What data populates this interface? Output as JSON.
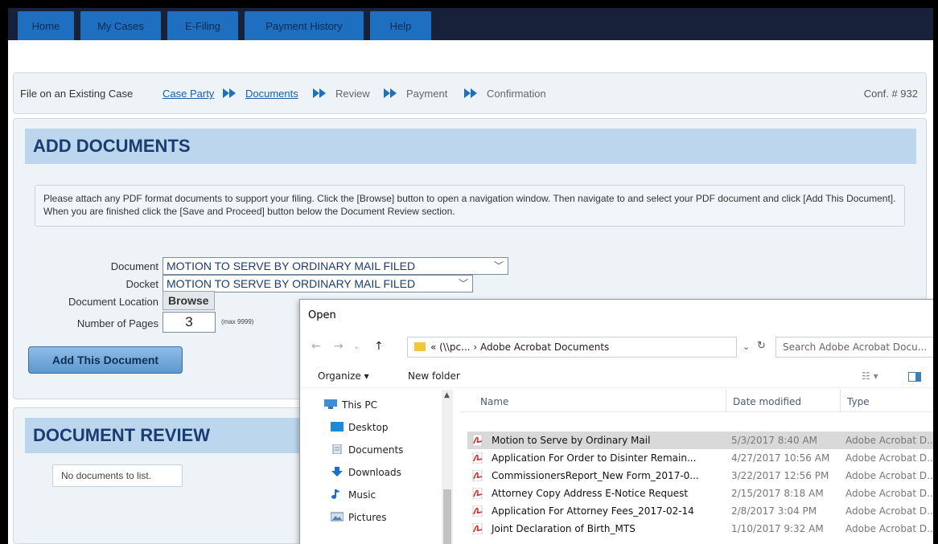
{
  "nav": {
    "tabs": [
      "Home",
      "My Cases",
      "E-Filing",
      "Payment History",
      "Help"
    ]
  },
  "breadcrumb": {
    "lead": "File on an Existing Case",
    "steps": [
      "Case Party",
      "Documents",
      "Review",
      "Payment",
      "Confirmation"
    ],
    "conf": "Conf. # 932"
  },
  "add_documents": {
    "title": "ADD DOCUMENTS",
    "instructions": "Please attach any PDF format documents to support your filing. Click the [Browse] button to open a navigation window. Then navigate to and select your PDF document and click [Add This Document]. When you are finished click the [Save and Proceed] button below the Document Review section.",
    "document_label": "Document",
    "document_value": "MOTION TO SERVE BY ORDINARY MAIL FILED",
    "docket_label": "Docket",
    "docket_value": "MOTION TO SERVE BY ORDINARY MAIL FILED",
    "location_label": "Document Location",
    "browse_label": "Browse",
    "pages_label": "Number of Pages",
    "pages_value": "3",
    "pages_max": "(max 9999)",
    "add_button": "Add This Document"
  },
  "document_review": {
    "title": "DOCUMENT REVIEW",
    "empty_text": "No documents to list."
  },
  "dialog": {
    "title": "Open",
    "address": "« (\\\\pc...  ›  Adobe Acrobat Documents",
    "search_placeholder": "Search Adobe Acrobat Docu...",
    "organize": "Organize ▾",
    "new_folder": "New folder",
    "columns": {
      "name": "Name",
      "date": "Date modified",
      "type": "Type"
    },
    "nav_items": [
      "This PC",
      "Desktop",
      "Documents",
      "Downloads",
      "Music",
      "Pictures"
    ],
    "files": [
      {
        "name": "Motion to Serve by Ordinary Mail",
        "date": "5/3/2017 8:40 AM",
        "type": "Adobe Acrobat D..."
      },
      {
        "name": "Application For Order to Disinter Remain...",
        "date": "4/27/2017 10:56 AM",
        "type": "Adobe Acrobat D..."
      },
      {
        "name": "CommissionersReport_New Form_2017-0...",
        "date": "3/22/2017 12:56 PM",
        "type": "Adobe Acrobat D..."
      },
      {
        "name": "Attorney Copy Address E-Notice Request",
        "date": "2/15/2017 8:18 AM",
        "type": "Adobe Acrobat D..."
      },
      {
        "name": "Application For Attorney Fees_2017-02-14",
        "date": "2/8/2017 3:04 PM",
        "type": "Adobe Acrobat D..."
      },
      {
        "name": "Joint Declaration of Birth_MTS",
        "date": "1/10/2017 9:32 AM",
        "type": "Adobe Acrobat D..."
      }
    ],
    "colors": {
      "accent": "#1e6fbf",
      "selection": "#d9d9d9",
      "pdf_red": "#d32f2f"
    }
  }
}
